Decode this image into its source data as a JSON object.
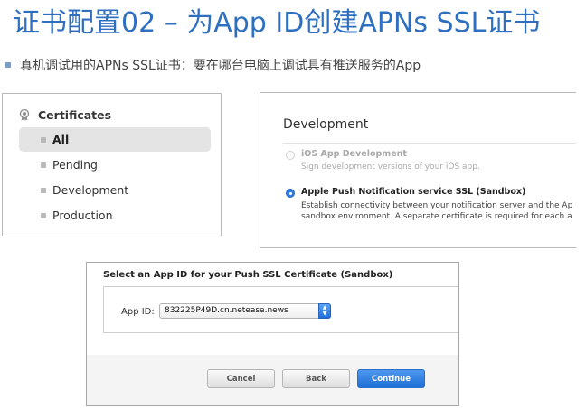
{
  "slide": {
    "title": "证书配置02 – 为App ID创建APNs SSL证书",
    "bullet": "真机调试用的APNs SSL证书：要在哪台电脑上调试具有推送服务的App"
  },
  "certificates_panel": {
    "header": "Certificates",
    "header_icon": "certificate-seal-icon",
    "items": [
      {
        "label": "All",
        "selected": true
      },
      {
        "label": "Pending",
        "selected": false
      },
      {
        "label": "Development",
        "selected": false
      },
      {
        "label": "Production",
        "selected": false
      }
    ]
  },
  "development_panel": {
    "heading": "Development",
    "options": [
      {
        "title": "iOS App Development",
        "description": "Sign development versions of your iOS app.",
        "selected": false
      },
      {
        "title": "Apple Push Notification service SSL (Sandbox)",
        "description_line1": "Establish connectivity between your notification server and the Ap",
        "description_line2": "sandbox environment. A separate certificate is required for each a",
        "selected": true
      }
    ]
  },
  "select_panel": {
    "title": "Select an App ID for your Push SSL Certificate (Sandbox)",
    "app_id_label": "App ID:",
    "app_id_value": "832225P49D.cn.netease.news",
    "buttons": {
      "cancel": "Cancel",
      "back": "Back",
      "continue": "Continue"
    }
  },
  "colors": {
    "title_blue": "#2e6fc0",
    "accent_blue": "#2f7ee5"
  }
}
